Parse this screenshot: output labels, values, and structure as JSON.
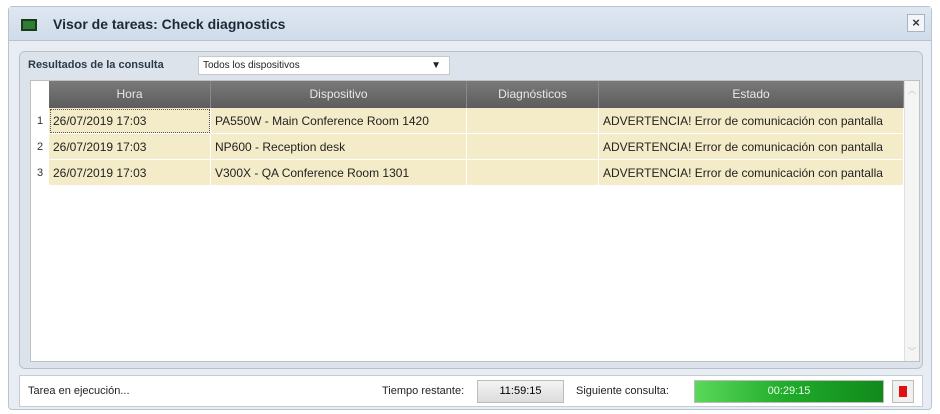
{
  "window": {
    "title": "Visor de tareas: Check diagnostics",
    "close": "×"
  },
  "query": {
    "label": "Resultados de la consulta",
    "selected": "Todos los dispositivos"
  },
  "table": {
    "columns": [
      "Hora",
      "Dispositivo",
      "Diagnósticos",
      "Estado"
    ],
    "rows": [
      {
        "n": "1",
        "hora": "26/07/2019 17:03",
        "dispositivo": "PA550W - Main Conference Room 1420",
        "diag": "",
        "estado": "ADVERTENCIA! Error de comunicación con pantalla"
      },
      {
        "n": "2",
        "hora": "26/07/2019 17:03",
        "dispositivo": "NP600 - Reception desk",
        "diag": "",
        "estado": "ADVERTENCIA! Error de comunicación con pantalla"
      },
      {
        "n": "3",
        "hora": "26/07/2019 17:03",
        "dispositivo": "V300X - QA Conference Room 1301",
        "diag": "",
        "estado": "ADVERTENCIA! Error de comunicación con pantalla"
      }
    ]
  },
  "status": {
    "text": "Tarea en ejecución...",
    "remaining_label": "Tiempo restante:",
    "remaining": "11:59:15",
    "next_label": "Siguiente consulta:",
    "next": "00:29:15",
    "next_progress": 1.0
  }
}
